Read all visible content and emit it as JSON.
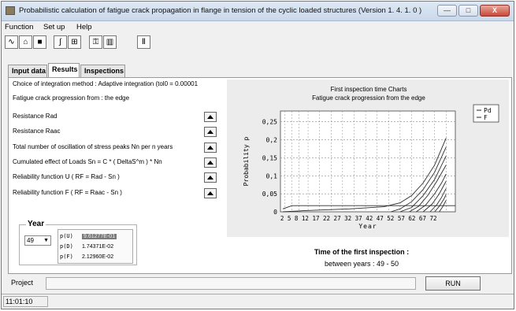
{
  "window": {
    "title": "Probabilistic calculation of fatigue crack propagation in flange in tension of the cyclic loaded structures (Version 1. 4. 1. 0 )",
    "buttons": {
      "minimize": "—",
      "maximize": "□",
      "close": "X"
    }
  },
  "menu": [
    {
      "label": "Function"
    },
    {
      "label": "Set up"
    },
    {
      "label": "Help"
    }
  ],
  "toolbar": [
    {
      "icon": "chart-wave-icon",
      "glyph": "∿"
    },
    {
      "icon": "open-folder-icon",
      "glyph": "⌂"
    },
    {
      "icon": "save-disk-icon",
      "glyph": "■"
    },
    {
      "icon": "integral-icon",
      "glyph": "∫"
    },
    {
      "icon": "graph-icon",
      "glyph": "⊞"
    },
    {
      "icon": "key-icon",
      "glyph": "⚿"
    },
    {
      "icon": "book-icon",
      "glyph": "▥"
    },
    {
      "icon": "structure-icon",
      "glyph": "Ⅱ"
    }
  ],
  "tabs": [
    {
      "label": "Input data",
      "active": false
    },
    {
      "label": "Results",
      "active": true
    },
    {
      "label": "Inspections",
      "active": false
    }
  ],
  "results": {
    "integration_method": "Choice of integration method : Adaptive integration (tol0 = 0.00001 ",
    "progression": "Fatigue crack progression from : the edge",
    "items": [
      {
        "label": "Resistance Rad"
      },
      {
        "label": "Resistance Raac"
      },
      {
        "label": "Total number of oscillation of stress peaks Nn per n years"
      },
      {
        "label": "Cumulated effect of Loads Sn = C * ( DeltaS^m ) * Nn"
      },
      {
        "label": "Reliability function U ( RF = Rad - Sn )"
      },
      {
        "label": "Reliability function F ( RF = Raac - Sn )"
      }
    ]
  },
  "year_box": {
    "title": "Year",
    "selected": "49",
    "values": [
      {
        "label": "p(U)",
        "value": "9.61277E-01",
        "selected": true
      },
      {
        "label": "p(D)",
        "value": "1.74371E-02",
        "selected": false
      },
      {
        "label": "p(F)",
        "value": "2.12960E-02",
        "selected": false
      }
    ]
  },
  "chart_data": {
    "type": "line",
    "title": "First inspection time Charts",
    "subtitle": "Fatigue crack progression from the edge",
    "xlabel": "Year",
    "ylabel": "Probability  p",
    "xlim": [
      0,
      76
    ],
    "ylim": [
      0,
      0.28
    ],
    "x_ticks": [
      2,
      5,
      8,
      12,
      17,
      22,
      27,
      32,
      37,
      42,
      47,
      52,
      57,
      62,
      67,
      72
    ],
    "y_ticks": [
      0,
      0.05,
      0.1,
      0.15,
      0.2,
      0.25
    ],
    "y_tick_labels": [
      "0",
      "0,05",
      "0,1",
      "0,15",
      "0,2",
      "0,25"
    ],
    "grid": true,
    "legend": {
      "position": "top-right",
      "entries": [
        "Pd",
        "F"
      ]
    },
    "colors": {
      "plot_bg": "#ffffff",
      "area_bg": "#ececec",
      "line": "#2b2b2b",
      "grid": "#8a8a8a"
    },
    "series": [
      {
        "name": "Pd",
        "x": [
          1,
          5,
          10,
          49,
          76
        ],
        "y": [
          0.008,
          0.017,
          0.017,
          0.017,
          0.017
        ]
      },
      {
        "name": "F",
        "x": [
          1,
          10,
          30,
          45,
          52,
          57,
          62,
          67,
          72
        ],
        "y": [
          0.0,
          0.003,
          0.008,
          0.014,
          0.025,
          0.045,
          0.08,
          0.13,
          0.205
        ]
      },
      {
        "x": [
          48,
          52,
          57,
          62,
          67,
          72
        ],
        "y": [
          0.0,
          0.008,
          0.028,
          0.062,
          0.11,
          0.18
        ]
      },
      {
        "x": [
          52,
          57,
          62,
          67,
          72
        ],
        "y": [
          0.0,
          0.012,
          0.045,
          0.09,
          0.155
        ]
      },
      {
        "x": [
          56,
          60,
          64,
          68,
          72
        ],
        "y": [
          0.0,
          0.015,
          0.045,
          0.085,
          0.13
        ]
      },
      {
        "x": [
          59,
          63,
          67,
          70,
          72
        ],
        "y": [
          0.0,
          0.018,
          0.05,
          0.08,
          0.105
        ]
      },
      {
        "x": [
          62,
          66,
          69,
          72
        ],
        "y": [
          0.0,
          0.022,
          0.05,
          0.085
        ]
      },
      {
        "x": [
          65,
          68,
          70,
          72
        ],
        "y": [
          0.0,
          0.02,
          0.04,
          0.065
        ]
      },
      {
        "x": [
          67,
          69,
          71,
          72
        ],
        "y": [
          0.0,
          0.015,
          0.035,
          0.048
        ]
      },
      {
        "x": [
          69,
          70.5,
          72
        ],
        "y": [
          0.0,
          0.014,
          0.032
        ]
      }
    ]
  },
  "inspection": {
    "title": "Time of the first inspection :",
    "value": "between years : 49 - 50"
  },
  "bottom": {
    "project_label": "Project",
    "run_label": "RUN"
  },
  "status": {
    "time": "11:01:10"
  }
}
